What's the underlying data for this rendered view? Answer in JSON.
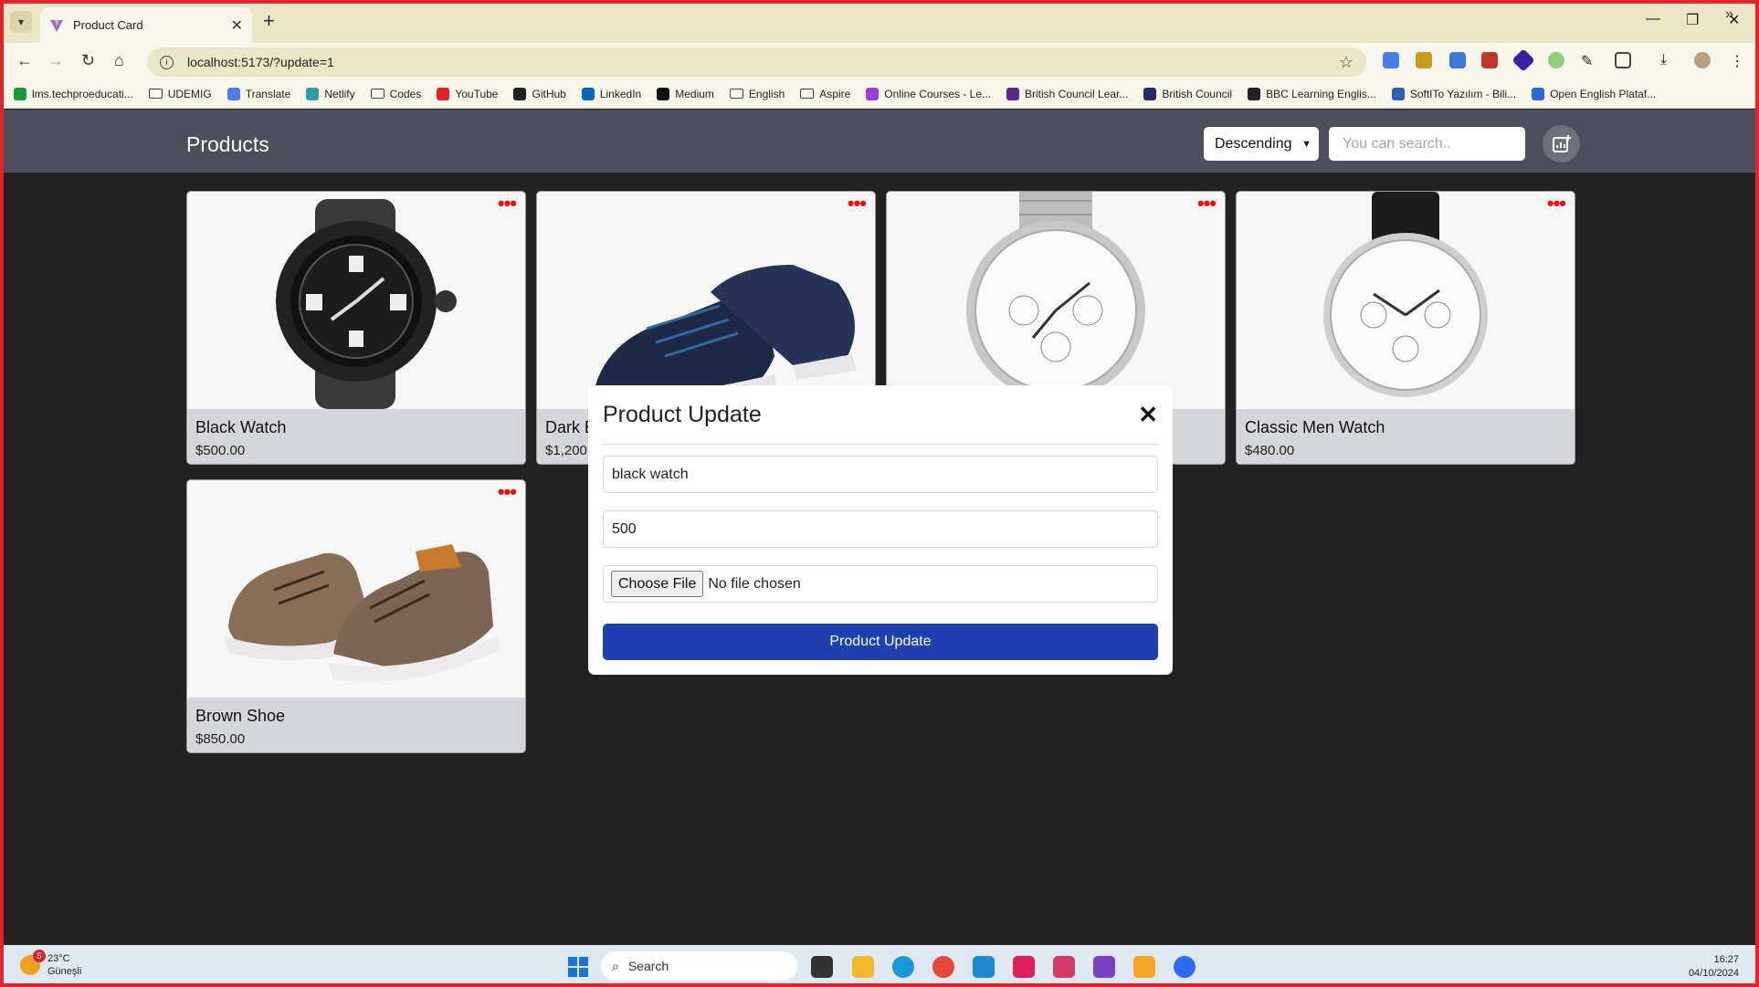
{
  "browser": {
    "tab_title": "Product Card",
    "url": "localhost:5173/?update=1",
    "bookmarks": [
      {
        "label": "lms.techproeducati...",
        "icon": "check-icon",
        "color": "#1b9a3a"
      },
      {
        "label": "UDEMIG",
        "icon": "folder-icon",
        "color": ""
      },
      {
        "label": "Translate",
        "icon": "translate-icon",
        "color": "#4a7de8"
      },
      {
        "label": "Netlify",
        "icon": "netlify-icon",
        "color": "#25a3a0"
      },
      {
        "label": "Codes",
        "icon": "folder-icon",
        "color": ""
      },
      {
        "label": "YouTube",
        "icon": "youtube-icon",
        "color": "#e0242a"
      },
      {
        "label": "GitHub",
        "icon": "github-icon",
        "color": "#222222"
      },
      {
        "label": "LinkedIn",
        "icon": "linkedin-icon",
        "color": "#0a66c2"
      },
      {
        "label": "Medium",
        "icon": "medium-icon",
        "color": "#111111"
      },
      {
        "label": "English",
        "icon": "folder-icon",
        "color": ""
      },
      {
        "label": "Aspire",
        "icon": "folder-icon",
        "color": ""
      },
      {
        "label": "Online Courses - Le...",
        "icon": "udemy-icon",
        "color": "#9b3fd6"
      },
      {
        "label": "British Council Lear...",
        "icon": "british-council-icon",
        "color": "#5a2a86"
      },
      {
        "label": "British Council",
        "icon": "british-council-icon",
        "color": "#2a2a6e"
      },
      {
        "label": "BBC Learning Englis...",
        "icon": "bbc-icon",
        "color": "#222222"
      },
      {
        "label": "SoftITo Yazılım - Bili...",
        "icon": "softito-icon",
        "color": "#2f5fb3"
      },
      {
        "label": "Open English Plataf...",
        "icon": "doc-icon",
        "color": "#2a6ad9"
      }
    ]
  },
  "app": {
    "title": "Products",
    "sort_value": "Descending",
    "search_placeholder": "You can search.."
  },
  "products": [
    {
      "name": "Black Watch",
      "price": "$500.00"
    },
    {
      "name": "Dark B",
      "price": "$1,200"
    },
    {
      "name": "",
      "price": ""
    },
    {
      "name": "Classic Men Watch",
      "price": "$480.00"
    },
    {
      "name": "Brown Shoe",
      "price": "$850.00"
    }
  ],
  "modal": {
    "title": "Product Update",
    "name_value": "black watch",
    "price_value": "500",
    "file_button": "Choose File",
    "file_status": "No file chosen",
    "submit_label": "Product Update"
  },
  "taskbar": {
    "weather_badge": "5",
    "temperature": "23°C",
    "condition": "Güneşli",
    "search_label": "Search",
    "time": "16:27",
    "date": "04/10/2024"
  }
}
